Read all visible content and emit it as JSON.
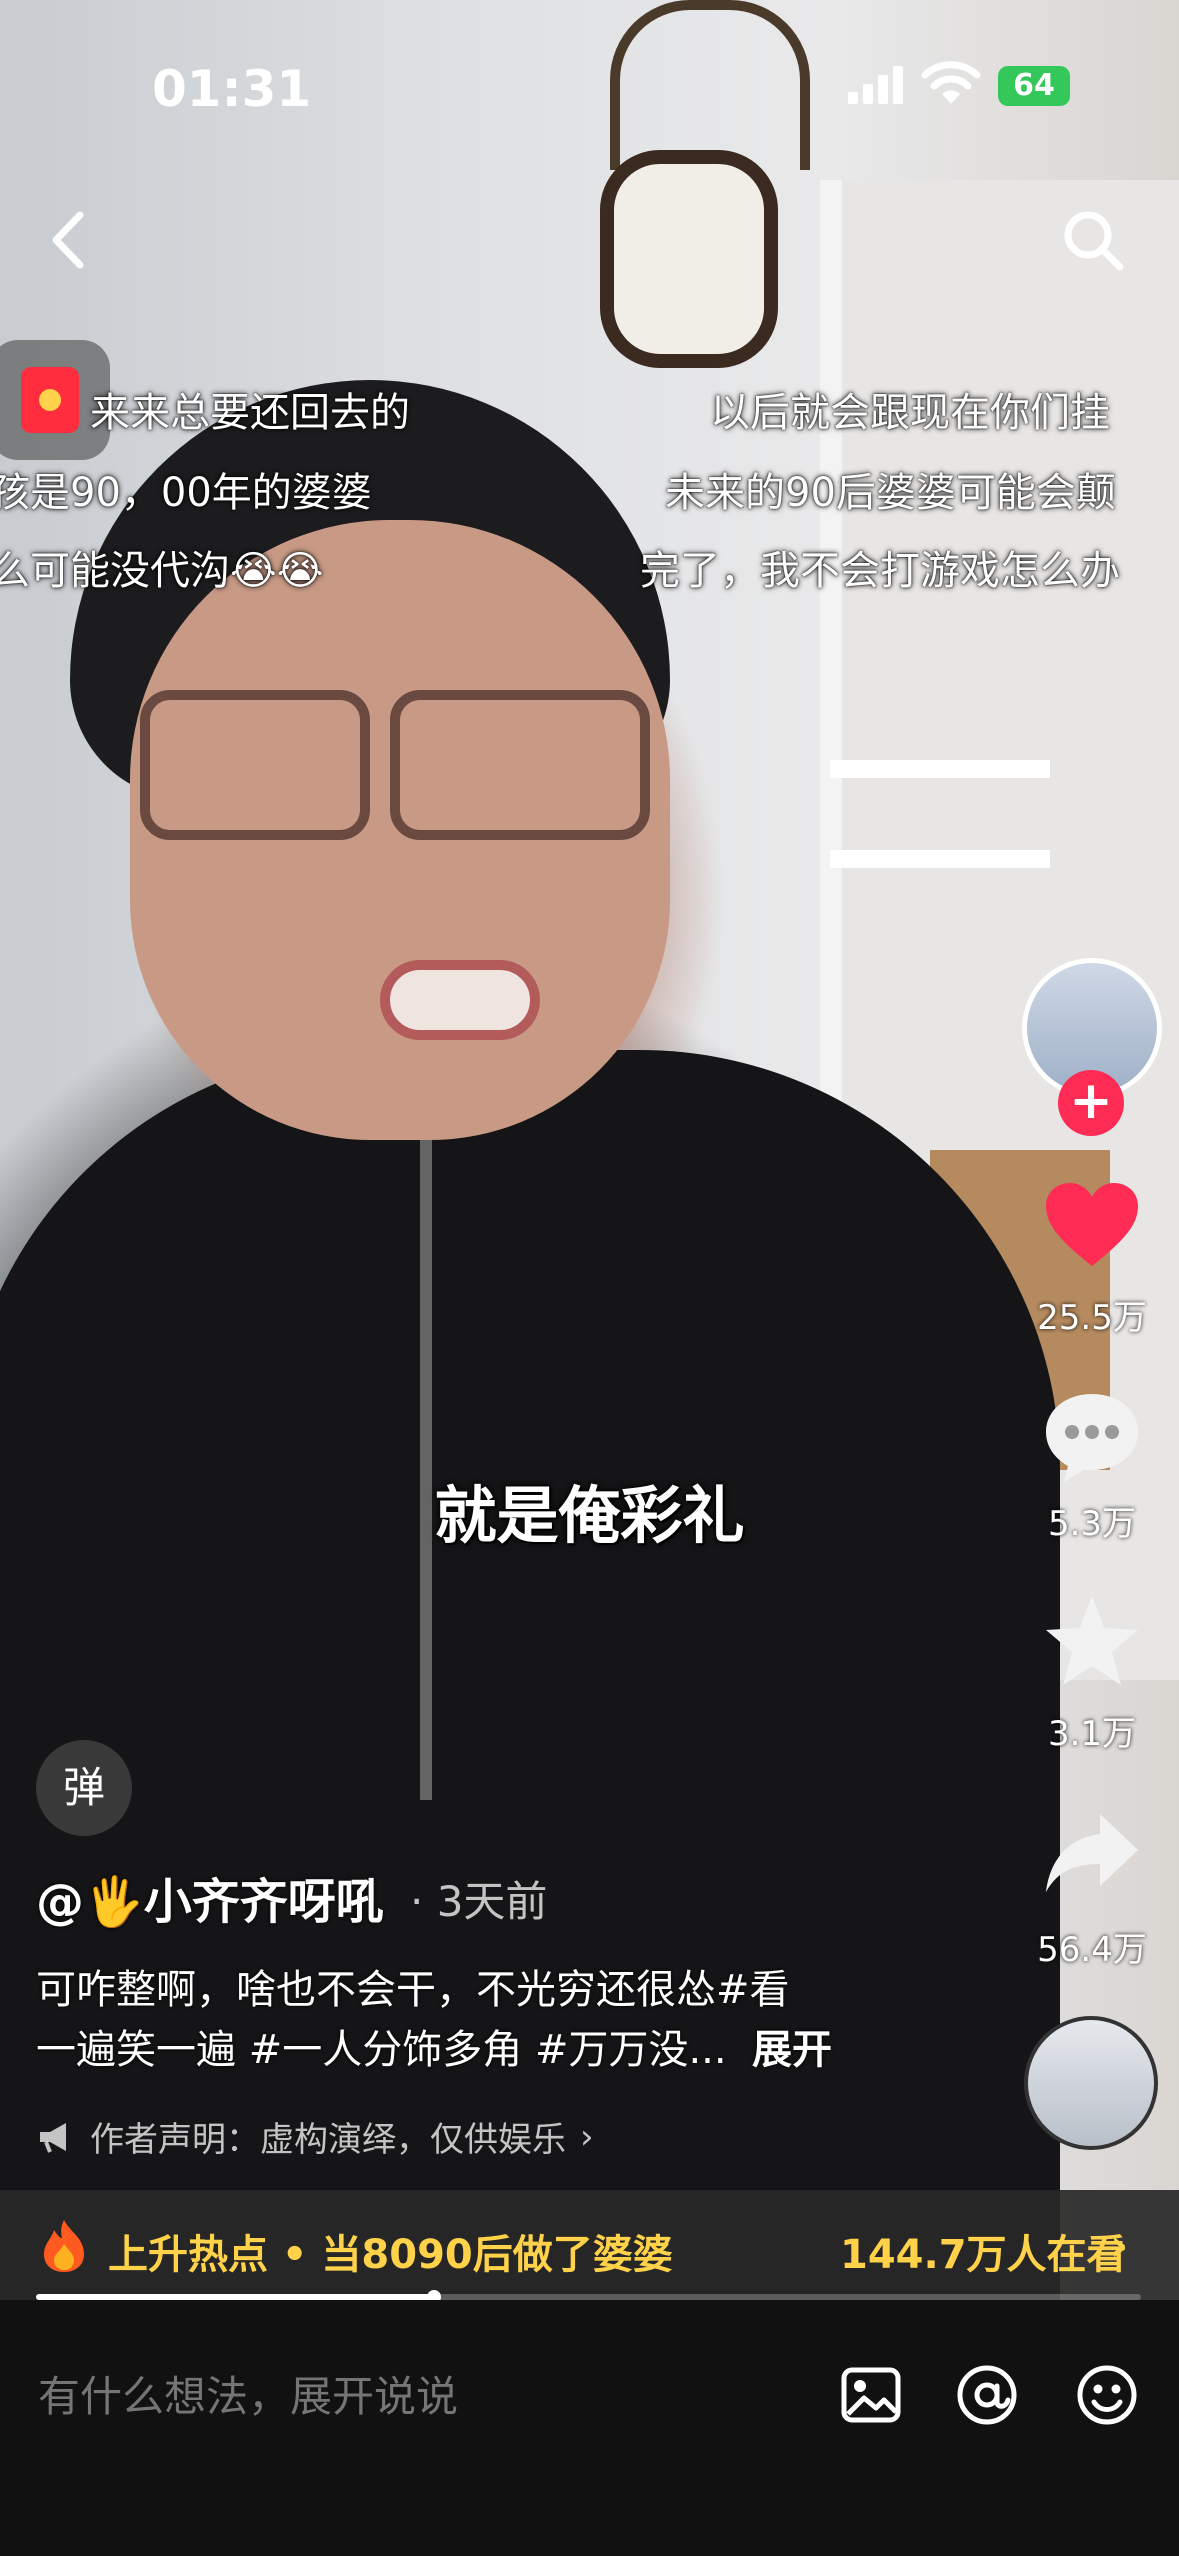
{
  "status_bar": {
    "time": "01:31",
    "battery": "64"
  },
  "overlay_comments": {
    "left": [
      "来来总要还回去的",
      "孩是90，00年的婆婆",
      "么可能没代沟😭😭"
    ],
    "right": [
      "以后就会跟现在你们挂",
      "未来的90后婆婆可能会颠",
      "完了，我不会打游戏怎么办"
    ]
  },
  "subtitle": "就是俺彩礼",
  "rail": {
    "likes": "25.5万",
    "comments": "5.3万",
    "favorites": "3.1万",
    "shares": "56.4万"
  },
  "danmu_label": "弹",
  "author": {
    "name": "@🖐小齐齐呀吼",
    "time_ago": "· 3天前"
  },
  "description": {
    "line1": "可咋整啊，啥也不会干，不光穷还很怂#看",
    "line2": "一遍笑一遍 #一人分饰多角 #万万没...",
    "expand": "展开"
  },
  "disclaimer": "作者声明：虚构演绎，仅供娱乐",
  "hot": {
    "text": "上升热点 • 当8090后做了婆婆",
    "count": "144.7万人在看"
  },
  "progress": 0.36,
  "comment_placeholder": "有什么想法，展开说说"
}
